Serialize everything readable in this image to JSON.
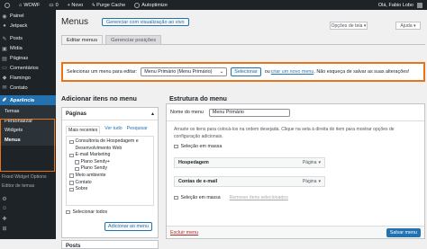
{
  "adminbar": {
    "site_name": "WOWF",
    "comments_count": "0",
    "new_label": "+ Novo",
    "purge_label": "Purge Cache",
    "autoptimize_label": "Autoptimize",
    "howdy": "Olá, Fabio Lobo"
  },
  "sidebar": {
    "items_top": [
      {
        "label": "Painel",
        "icon": "dashboard-icon"
      },
      {
        "label": "Jetpack",
        "icon": "jetpack-icon"
      },
      {
        "label": "Posts",
        "icon": "pin-icon"
      },
      {
        "label": "Mídia",
        "icon": "media-icon"
      },
      {
        "label": "Páginas",
        "icon": "pages-icon"
      },
      {
        "label": "Comentários",
        "icon": "comments-icon"
      },
      {
        "label": "Flamingo",
        "icon": "flamingo-icon"
      },
      {
        "label": "Contato",
        "icon": "mail-icon"
      }
    ],
    "active_label": "Aparência",
    "submenu": [
      "Temas",
      "Personalizar",
      "Widgets",
      "Menus"
    ],
    "mini_links": [
      "Fixed Widget Options",
      "Editor de temas"
    ],
    "items_bottom": [
      {
        "label": "Plugins",
        "icon": "plugin-icon"
      },
      {
        "label": "Usuários",
        "icon": "users-icon"
      },
      {
        "label": "Ferramentas",
        "icon": "tools-icon"
      },
      {
        "label": "Configurações",
        "icon": "settings-icon"
      }
    ]
  },
  "header": {
    "title": "Menus",
    "manage_live": "Gerenciar com visualização ao vivo",
    "screen_options": "Opções de tela ▾",
    "help": "Ajuda ▾"
  },
  "tabs": [
    "Editar menus",
    "Gerenciar posições"
  ],
  "select_bar": {
    "label": "Selecionar um menu para editar:",
    "selected": "Menu Primário (Menu Primário)",
    "button": "Selecionar",
    "or": "ou",
    "create_link": "criar um novo menu",
    "tail": ". Não esqueça de salvar as suas alterações!"
  },
  "left": {
    "heading": "Adicionar itens no menu",
    "panel_title": "Páginas",
    "sub_tabs": [
      "Mais recentes",
      "Ver tudo",
      "Pesquisar"
    ],
    "pages": [
      {
        "label": "Consultoria de Hospedagem e",
        "level": 0,
        "checkbox": true
      },
      {
        "label": "Desenvolvimento Web",
        "level": 0,
        "checkbox": false
      },
      {
        "label": "E-mail Marketing",
        "level": 0,
        "checkbox": true
      },
      {
        "label": "Plano Sendy+",
        "level": 1,
        "checkbox": true
      },
      {
        "label": "Plano Sendy",
        "level": 1,
        "checkbox": true
      },
      {
        "label": "Meio ambiente",
        "level": 0,
        "checkbox": true
      },
      {
        "label": "Contato",
        "level": 0,
        "checkbox": true
      },
      {
        "label": "Sobre",
        "level": 0,
        "checkbox": true
      }
    ],
    "select_all": "Selecionar todos",
    "add_button": "Adicionar ao menu",
    "panel2_title": "Posts"
  },
  "right": {
    "heading": "Estrutura do menu",
    "name_label": "Nome do menu",
    "name_value": "Menu Primário",
    "instructions": "Arraste os itens para colocá-los na ordem desejada. Clique na seta à direita do item para mostrar opções de configuração adicionais.",
    "bulk_select": "Seleção em massa",
    "items": [
      {
        "label": "Hospedagem",
        "type": "Página"
      },
      {
        "label": "Contas de e-mail",
        "type": "Página"
      }
    ],
    "remove_selected": "Remover itens selecionados",
    "delete_menu": "Excluir menu",
    "save_menu": "Salvar menu"
  }
}
